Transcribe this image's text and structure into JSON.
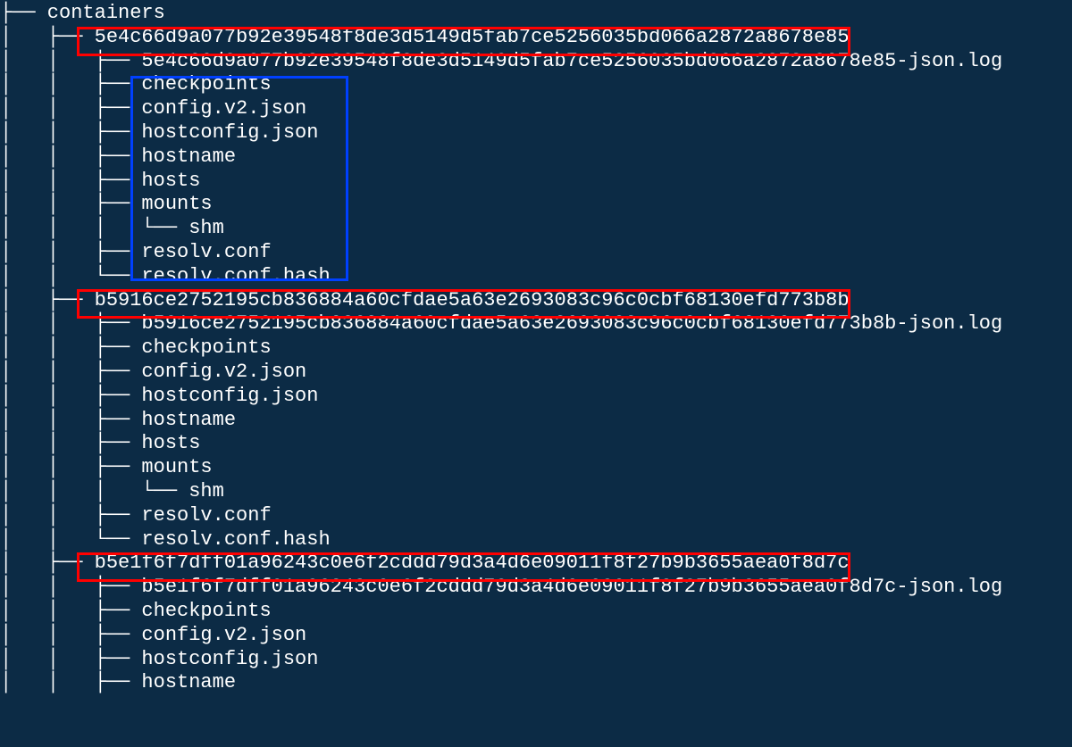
{
  "colors": {
    "background": "#0c2b45",
    "foreground": "#ffffff",
    "highlight_red": "#ff0000",
    "highlight_blue": "#0040ff"
  },
  "title": "containers",
  "tree": {
    "root": "containers",
    "containers": [
      {
        "id": "5e4c66d9a077b92e39548f8de3d5149d5fab7ce5256035bd066a2872a8678e85",
        "log": "5e4c66d9a077b92e39548f8de3d5149d5fab7ce5256035bd066a2872a8678e85-json.log",
        "files": [
          "checkpoints",
          "config.v2.json",
          "hostconfig.json",
          "hostname",
          "hosts",
          "mounts",
          "shm",
          "resolv.conf",
          "resolv.conf.hash"
        ]
      },
      {
        "id": "b5916ce2752195cb836884a60cfdae5a63e2693083c96c0cbf68130efd773b8b",
        "log": "b5916ce2752195cb836884a60cfdae5a63e2693083c96c0cbf68130efd773b8b-json.log",
        "files": [
          "checkpoints",
          "config.v2.json",
          "hostconfig.json",
          "hostname",
          "hosts",
          "mounts",
          "shm",
          "resolv.conf",
          "resolv.conf.hash"
        ]
      },
      {
        "id": "b5e1f6f7dff01a96243c0e6f2cddd79d3a4d6e09011f8f27b9b3655aea0f8d7c",
        "log": "b5e1f6f7dff01a96243c0e6f2cddd79d3a4d6e09011f8f27b9b3655aea0f8d7c-json.log",
        "files": [
          "checkpoints",
          "config.v2.json",
          "hostconfig.json",
          "hostname"
        ]
      }
    ]
  },
  "lines": {
    "l0": "├── containers",
    "l1": "│   ├── 5e4c66d9a077b92e39548f8de3d5149d5fab7ce5256035bd066a2872a8678e85",
    "l2": "│   │   ├── 5e4c66d9a077b92e39548f8de3d5149d5fab7ce5256035bd066a2872a8678e85-json.log",
    "l3": "│   │   ├── checkpoints",
    "l4": "│   │   ├── config.v2.json",
    "l5": "│   │   ├── hostconfig.json",
    "l6": "│   │   ├── hostname",
    "l7": "│   │   ├── hosts",
    "l8": "│   │   ├── mounts",
    "l9": "│   │   │   └── shm",
    "l10": "│   │   ├── resolv.conf",
    "l11": "│   │   └── resolv.conf.hash",
    "l12": "│   ├── b5916ce2752195cb836884a60cfdae5a63e2693083c96c0cbf68130efd773b8b",
    "l13": "│   │   ├── b5916ce2752195cb836884a60cfdae5a63e2693083c96c0cbf68130efd773b8b-json.log",
    "l14": "│   │   ├── checkpoints",
    "l15": "│   │   ├── config.v2.json",
    "l16": "│   │   ├── hostconfig.json",
    "l17": "│   │   ├── hostname",
    "l18": "│   │   ├── hosts",
    "l19": "│   │   ├── mounts",
    "l20": "│   │   │   └── shm",
    "l21": "│   │   ├── resolv.conf",
    "l22": "│   │   └── resolv.conf.hash",
    "l23": "│   ├── b5e1f6f7dff01a96243c0e6f2cddd79d3a4d6e09011f8f27b9b3655aea0f8d7c",
    "l24": "│   │   ├── b5e1f6f7dff01a96243c0e6f2cddd79d3a4d6e09011f8f27b9b3655aea0f8d7c-json.log",
    "l25": "│   │   ├── checkpoints",
    "l26": "│   │   ├── config.v2.json",
    "l27": "│   │   ├── hostconfig.json",
    "l28": "│   │   ├── hostname"
  }
}
